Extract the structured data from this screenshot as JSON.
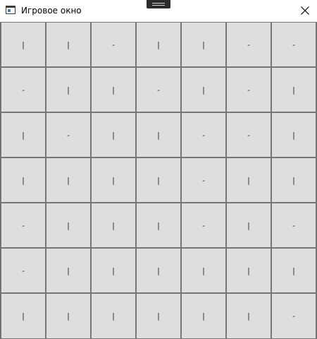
{
  "window": {
    "title": "Игровое окно",
    "close_label": "close"
  },
  "board": {
    "rows": 7,
    "cols": 7,
    "cells": [
      [
        "|",
        "|",
        "-",
        "|",
        "|",
        "-",
        "-"
      ],
      [
        "-",
        "|",
        "|",
        "-",
        "|",
        "-",
        "|"
      ],
      [
        "|",
        "-",
        "|",
        "|",
        "-",
        "-",
        "|"
      ],
      [
        "|",
        "|",
        "|",
        "|",
        "-",
        "|",
        "|"
      ],
      [
        "-",
        "|",
        "|",
        "|",
        "-",
        "|",
        "-"
      ],
      [
        "-",
        "|",
        "|",
        "|",
        "|",
        "|",
        "|"
      ],
      [
        "|",
        "|",
        "|",
        "|",
        "|",
        "|",
        "-"
      ]
    ]
  },
  "colors": {
    "cell_background": "#dedede",
    "cell_border": "#777777",
    "grid_lines": "#6e6e6e",
    "titlebar": "#ffffff"
  },
  "icons": {
    "app": "app-window-icon",
    "close": "close-icon",
    "handle": "drag-handle-icon"
  }
}
